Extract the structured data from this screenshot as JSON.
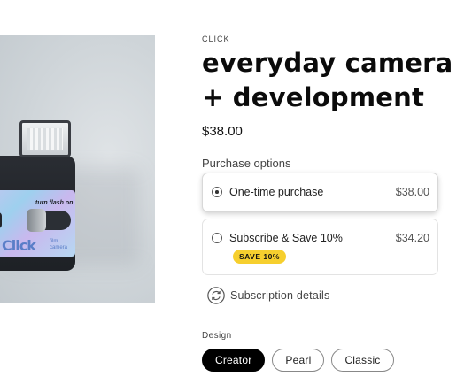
{
  "product": {
    "vendor": "CLICK",
    "title": "everyday camera + development",
    "price": "$38.00"
  },
  "purchase_options": {
    "label": "Purchase options",
    "options": [
      {
        "name": "One-time purchase",
        "price": "$38.00",
        "selected": true
      },
      {
        "name": "Subscribe & Save 10%",
        "price": "$34.20",
        "badge": "SAVE 10%",
        "selected": false
      }
    ]
  },
  "subscription_details": {
    "label": "Subscription details",
    "icon": "subscription-refresh-icon"
  },
  "design": {
    "label": "Design",
    "options": [
      "Creator",
      "Pearl",
      "Classic"
    ],
    "selected": "Creator"
  },
  "photo_text": {
    "flash_label": "turn flash on",
    "brand": "Click",
    "tagline": "film camera"
  },
  "colors": {
    "badge": "#f6cf2e",
    "selected_pill": "#000000"
  }
}
